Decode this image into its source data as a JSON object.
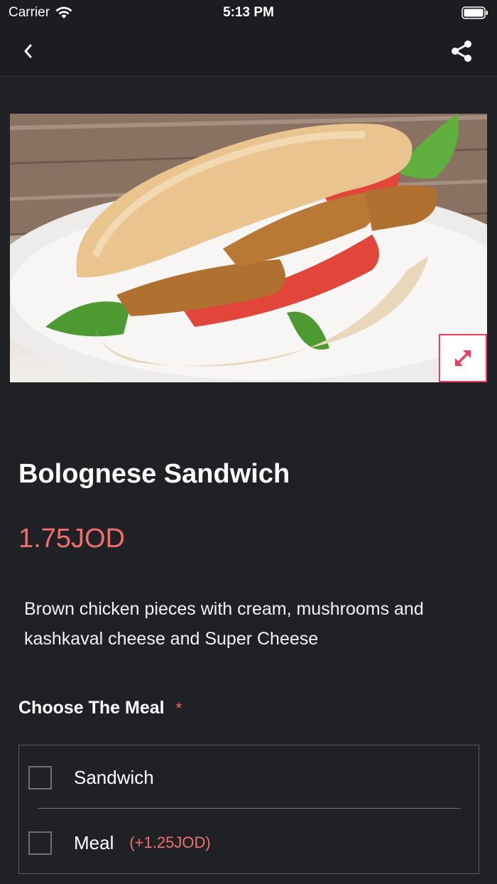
{
  "status_bar": {
    "carrier": "Carrier",
    "time": "5:13 PM",
    "wifi_icon": "wifi-icon",
    "battery_icon": "battery-icon"
  },
  "nav": {
    "back_icon": "chevron-left-icon",
    "share_icon": "share-icon"
  },
  "product": {
    "image_icon": "sandwich-photo",
    "expand_icon": "expand-arrows-icon",
    "title": "Bolognese Sandwich",
    "price": "1.75JOD",
    "description": "Brown chicken pieces with cream, mushrooms and kashkaval cheese and Super Cheese"
  },
  "meal_section": {
    "title": "Choose The Meal",
    "required_mark": "*",
    "options": [
      {
        "label": "Sandwich",
        "extra": "",
        "checked": false
      },
      {
        "label": "Meal",
        "extra": "(+1.25JOD)",
        "checked": false
      }
    ]
  },
  "colors": {
    "background": "#202125",
    "accent": "#f06f6f",
    "expand_border": "#ef3b59"
  }
}
